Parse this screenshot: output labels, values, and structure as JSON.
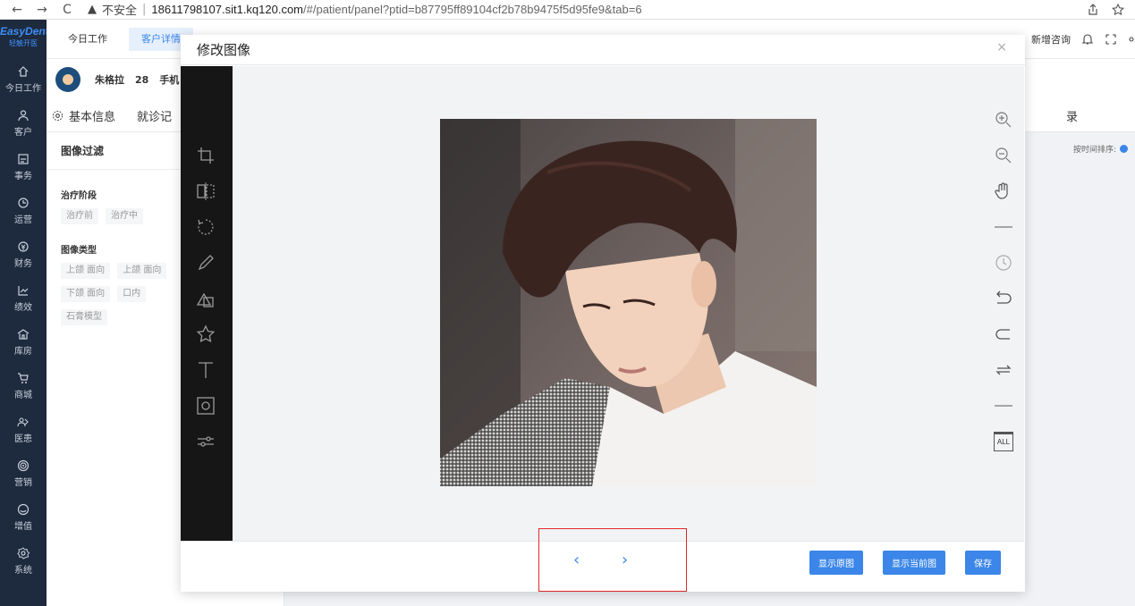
{
  "browser": {
    "back": "←",
    "forward": "→",
    "reload": "C",
    "warning": "▲",
    "insecure": "不安全",
    "separator": "|",
    "url_host": "18611798107.sit1.kq120.com",
    "url_path": "/#/patient/panel?ptid=b87795ff89104cf2b78b9475f5d95fe9&tab=6"
  },
  "brand": {
    "name": "EasyDent",
    "sub": "轻触开医"
  },
  "sidebar": {
    "items": [
      {
        "label": "今日工作",
        "icon": "home-icon"
      },
      {
        "label": "客户",
        "icon": "user-icon"
      },
      {
        "label": "事务",
        "icon": "task-icon"
      },
      {
        "label": "运营",
        "icon": "clock-icon"
      },
      {
        "label": "财务",
        "icon": "money-icon"
      },
      {
        "label": "绩效",
        "icon": "chart-icon"
      },
      {
        "label": "库房",
        "icon": "warehouse-icon"
      },
      {
        "label": "商城",
        "icon": "cart-icon"
      },
      {
        "label": "医患",
        "icon": "doctor-icon"
      },
      {
        "label": "营销",
        "icon": "target-icon"
      },
      {
        "label": "增值",
        "icon": "value-icon"
      },
      {
        "label": "系统",
        "icon": "settings-icon"
      }
    ]
  },
  "topbar": {
    "tabs": [
      "今日工作",
      "客户详情"
    ],
    "new_consult": "新增咨询"
  },
  "patient": {
    "name": "朱格拉",
    "age": "28",
    "phone": "手机"
  },
  "patient_tabs": {
    "basic": "基本信息",
    "visit": "就诊记",
    "tail": "录"
  },
  "filter": {
    "title": "图像过滤",
    "stage_title": "治疗阶段",
    "stages": [
      "治疗前",
      "治疗中"
    ],
    "type_title": "图像类型",
    "types": [
      "上颌 面向",
      "上颌 面向",
      "下颌 面向",
      "口内",
      "石膏模型"
    ]
  },
  "sort_label": "按时间排序:",
  "modal": {
    "title": "修改图像",
    "close": "×",
    "prev": "‹",
    "next": "›",
    "btn_original": "显示原图",
    "btn_current": "显示当前图",
    "btn_save": "保存",
    "all_label": "ALL"
  },
  "colors": {
    "primary": "#3b86e8",
    "sidebar": "#1e2a3d",
    "highlight": "#e2282b",
    "toolbar": "#161616"
  }
}
